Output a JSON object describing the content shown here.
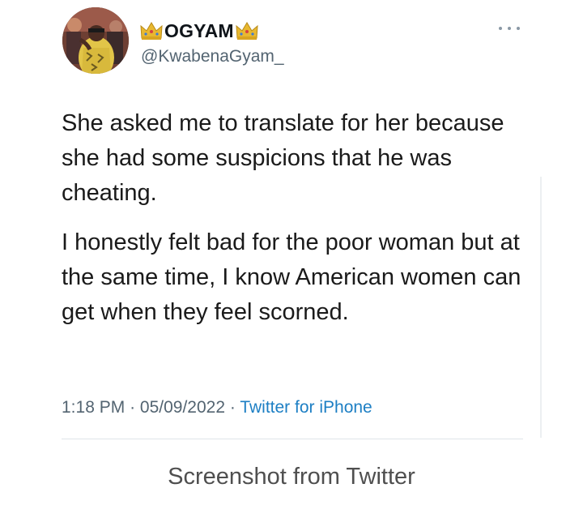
{
  "tweet": {
    "display_name": "OGYAM",
    "handle": "@KwabenaGyam_",
    "name_icons": [
      "crown-emoji",
      "crown-emoji"
    ],
    "paragraphs": [
      "She asked me to translate for her because she had some suspicions that he was cheating.",
      "I honestly felt bad for the poor woman but at the same time, I know American women can get when they feel scorned."
    ],
    "time": "1:18 PM",
    "date": "05/09/2022",
    "source": "Twitter for iPhone",
    "separator": "·"
  },
  "caption": "Screenshot from Twitter",
  "colors": {
    "text": "#0f1419",
    "muted": "#536471",
    "link": "#1d7fc4",
    "crown": "#e8b830"
  }
}
